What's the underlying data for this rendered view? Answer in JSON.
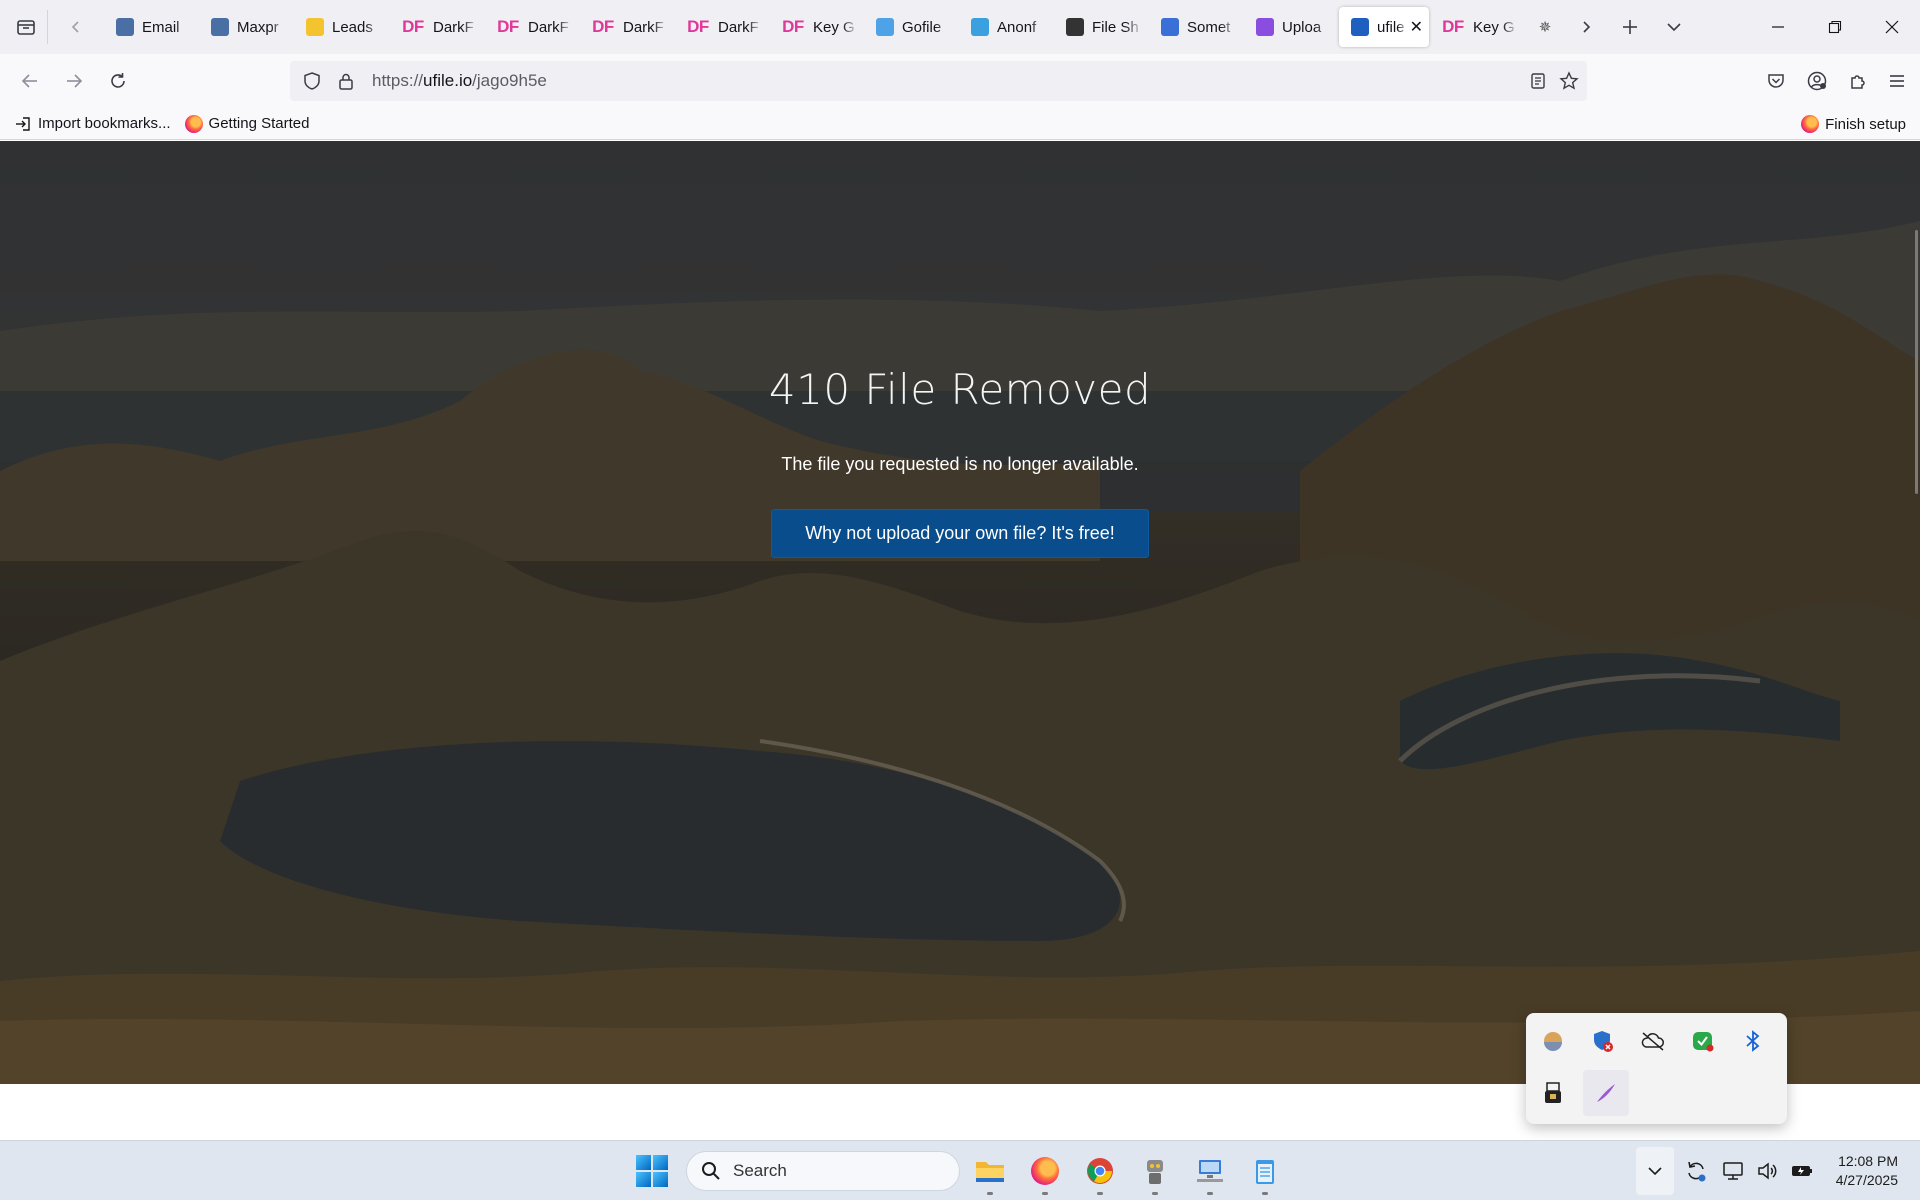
{
  "tabs": [
    {
      "label": "Email",
      "favicon": "email-favicon",
      "color": "#4a6fa5"
    },
    {
      "label": "Maxpr",
      "favicon": "maxpr-favicon",
      "color": "#4a6fa5"
    },
    {
      "label": "Leads",
      "favicon": "leads-favicon",
      "color": "#f4c430"
    },
    {
      "label": "DarkF",
      "favicon": "df-favicon",
      "color": "#e0389a"
    },
    {
      "label": "DarkF",
      "favicon": "df-favicon",
      "color": "#e0389a"
    },
    {
      "label": "DarkF",
      "favicon": "df-favicon",
      "color": "#e0389a"
    },
    {
      "label": "DarkF",
      "favicon": "df-favicon",
      "color": "#e0389a"
    },
    {
      "label": "Key G",
      "favicon": "df-favicon",
      "color": "#e0389a"
    },
    {
      "label": "Gofile",
      "favicon": "gofile-favicon",
      "color": "#4ea3e8"
    },
    {
      "label": "Anonf",
      "favicon": "anonfiles-favicon",
      "color": "#3aa0e0"
    },
    {
      "label": "File Sh",
      "favicon": "fileshare-favicon",
      "color": "#333333"
    },
    {
      "label": "Somet",
      "favicon": "somet-favicon",
      "color": "#3a6fd8"
    },
    {
      "label": "Uploa",
      "favicon": "upload-favicon",
      "color": "#8a4de0"
    },
    {
      "label": "ufile",
      "favicon": "ufile-favicon",
      "color": "#1f5fbf",
      "active": true
    },
    {
      "label": "Key G",
      "favicon": "df-favicon",
      "color": "#e0389a"
    }
  ],
  "nav": {
    "url_prefix": "https://",
    "url_domain": "ufile.io",
    "url_path": "/jago9h5e"
  },
  "bookmarks": {
    "import": "Import bookmarks...",
    "getting_started": "Getting Started",
    "finish_setup": "Finish setup"
  },
  "page": {
    "heading": "410 File Removed",
    "message": "The file you requested is no longer available.",
    "cta": "Why not upload your own file? It's free!",
    "cta_color": "#0a4d8c"
  },
  "taskbar": {
    "search_placeholder": "Search",
    "time": "12:08 PM",
    "date": "4/27/2025"
  }
}
